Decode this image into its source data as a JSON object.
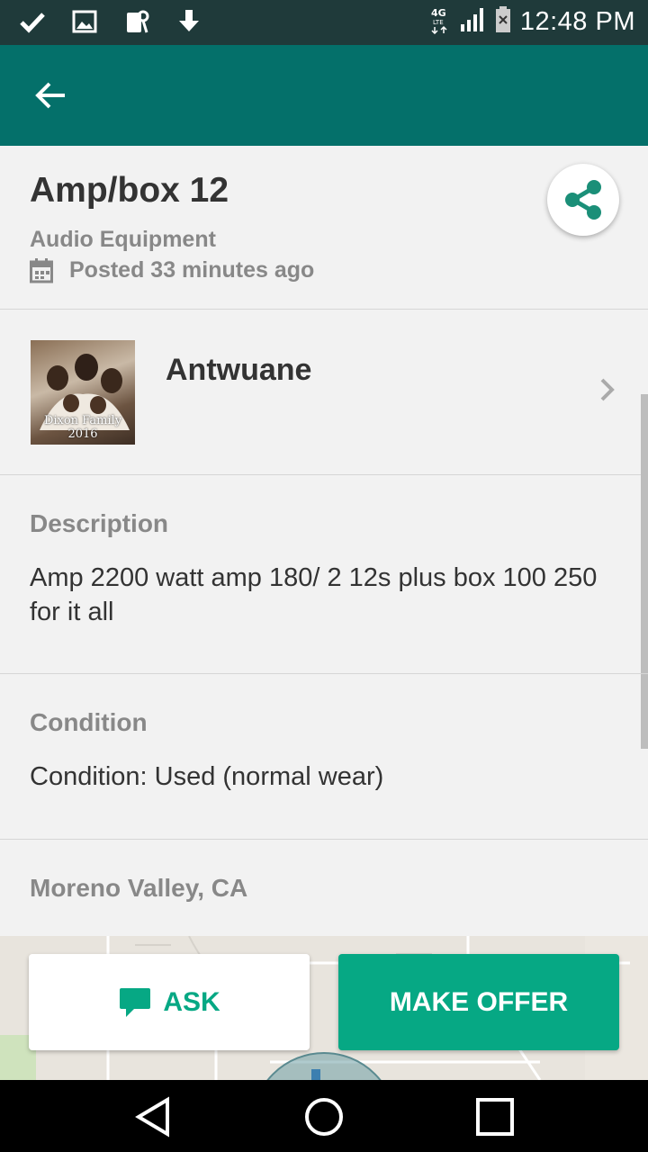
{
  "status_bar": {
    "time": "12:48 PM",
    "network": "4G LTE"
  },
  "app_bar": {
    "back_icon": "arrow-left-icon"
  },
  "listing": {
    "title": "Amp/box 12",
    "category": "Audio Equipment",
    "posted": "Posted 33 minutes ago"
  },
  "seller": {
    "name": "Antwuane",
    "photo_caption_line1": "Dixon Family",
    "photo_caption_line2": "2016"
  },
  "description": {
    "title": "Description",
    "text": "Amp 2200 watt amp 180/ 2 12s plus box 100 250 for it all"
  },
  "condition": {
    "title": "Condition",
    "text": "Condition: Used (normal wear)"
  },
  "location": {
    "title": "Moreno Valley, CA"
  },
  "actions": {
    "ask_label": "ASK",
    "offer_label": "MAKE OFFER"
  },
  "colors": {
    "status_bar": "#1f3a3a",
    "app_bar": "#04706a",
    "accent": "#06a884"
  }
}
